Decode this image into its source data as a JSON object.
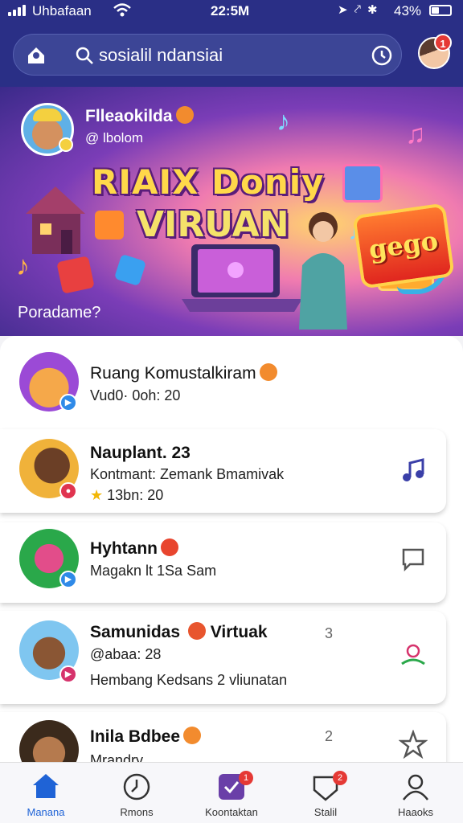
{
  "status_bar": {
    "carrier": "Uhbafaan",
    "time": "22:5M",
    "battery": "43%"
  },
  "header": {
    "search_text": "sosialil ndansiai",
    "notification_count": "1"
  },
  "banner": {
    "user_name": "Flleaokilda",
    "user_sub": "@ lbolom",
    "title_line1": "RIAIX Doniy",
    "title_line2": "VIRUAN",
    "question": "Poradame?",
    "sticker_text": "gego"
  },
  "list": {
    "items": [
      {
        "title": "Ruang Komustalkiram",
        "line2": "Vud0· 0oh: 20",
        "line3": "",
        "count": "",
        "badge_color": "#2f8ae8"
      },
      {
        "title": "Nauplant. 23",
        "line2": "Kontmant: Zemank Bmamivak",
        "line3": "13bn: 20",
        "count": "",
        "badge_color": "#e0344f"
      },
      {
        "title": "Hyhtann",
        "line2": "Magakn lt 1Sa Sam",
        "line3": "",
        "count": "",
        "badge_color": "#2f8ae8"
      },
      {
        "title": "Samunidas Virtuak",
        "line2": "@abaa: 28",
        "line3": "Hembang Kedsans 2 vliunatan",
        "count": "3",
        "badge_color": "#d6336c"
      },
      {
        "title": "Inila Bdbee",
        "line2": "Mrandry",
        "line3": "",
        "count": "2",
        "badge_color": "#2f8ae8"
      }
    ]
  },
  "bottom_nav": {
    "items": [
      {
        "label": "Manana",
        "icon": "home-icon",
        "active": true
      },
      {
        "label": "Rmons",
        "icon": "clock-icon",
        "active": false
      },
      {
        "label": "Koontaktan",
        "icon": "chat-icon",
        "active": false,
        "badge": "1"
      },
      {
        "label": "Stalil",
        "icon": "shield-icon",
        "active": false,
        "badge": "2"
      },
      {
        "label": "Haaoks",
        "icon": "profile-icon",
        "active": false
      }
    ]
  },
  "colors": {
    "header_bg": "#2a2f86",
    "accent": "#1f63d6",
    "badge_red": "#e53935"
  }
}
